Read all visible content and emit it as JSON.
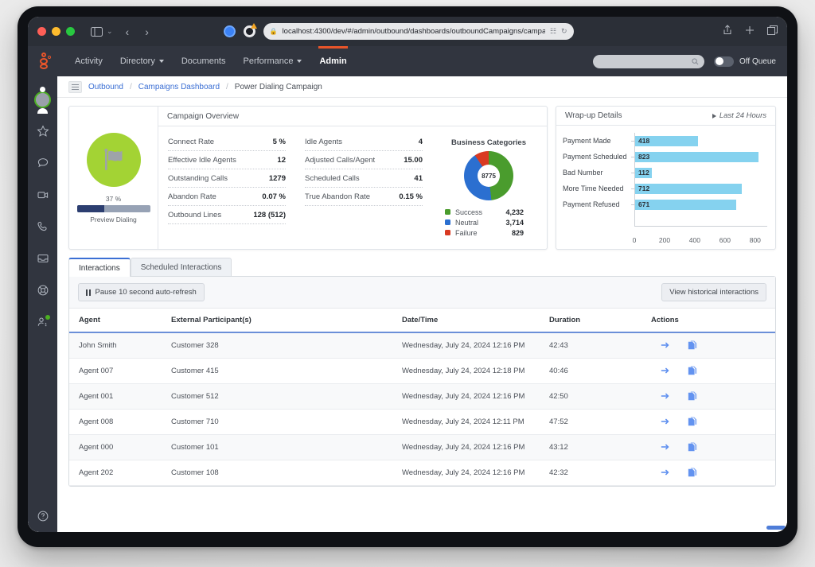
{
  "browser": {
    "url_visible": "localhost:4300/dev/#/admin/outbound/dashboards/outboundCampaigns/campaignDe",
    "url_truncated_tail": "campaignDe",
    "lock_icon": "lock-icon",
    "back_label": "‹",
    "forward_label": "›",
    "chevron": "⌄"
  },
  "topnav": {
    "items": [
      {
        "label": "Activity",
        "has_caret": false,
        "active": false
      },
      {
        "label": "Directory",
        "has_caret": true,
        "active": false
      },
      {
        "label": "Documents",
        "has_caret": false,
        "active": false
      },
      {
        "label": "Performance",
        "has_caret": true,
        "active": false
      },
      {
        "label": "Admin",
        "has_caret": false,
        "active": true
      }
    ],
    "search_placeholder": "",
    "queue_toggle_label": "Off Queue",
    "queue_toggle_state": "off"
  },
  "rail": {
    "items": [
      "avatar",
      "star-icon",
      "chat-icon",
      "video-icon",
      "phone-icon",
      "inbox-icon",
      "lifebuoy-icon",
      "people-icon"
    ],
    "help_label": "?"
  },
  "breadcrumb": {
    "items": [
      {
        "label": "Outbound",
        "current": false
      },
      {
        "label": "Campaigns Dashboard",
        "current": false
      },
      {
        "label": "Power Dialing Campaign",
        "current": true
      }
    ],
    "separator": "/"
  },
  "gauge": {
    "percent_label": "37 %",
    "percent_value": 37,
    "caption": "Preview Dialing",
    "circle_color": "#a3d334",
    "bar_fill_color": "#2c3e70",
    "bar_track_color": "#97a2b5",
    "icon": "flag-icon"
  },
  "overview": {
    "title": "Campaign Overview",
    "column_left": [
      {
        "label": "Connect Rate",
        "value": "5 %"
      },
      {
        "label": "Effective Idle Agents",
        "value": "12"
      },
      {
        "label": "Outstanding Calls",
        "value": "1279"
      },
      {
        "label": "Abandon Rate",
        "value": "0.07 %"
      },
      {
        "label": "Outbound Lines",
        "value": "128 (512)"
      }
    ],
    "column_right": [
      {
        "label": "Idle Agents",
        "value": "4"
      },
      {
        "label": "Adjusted Calls/Agent",
        "value": "15.00"
      },
      {
        "label": "Scheduled Calls",
        "value": "41"
      },
      {
        "label": "True Abandon Rate",
        "value": "0.15 %"
      }
    ]
  },
  "chart_data": [
    {
      "type": "pie",
      "title": "Business Categories",
      "center_label": "8775",
      "total": 8775,
      "categories": [
        "Success",
        "Neutral",
        "Failure"
      ],
      "values": [
        4232,
        3714,
        829
      ],
      "value_labels": [
        "4,232",
        "3,714",
        "829"
      ],
      "colors": [
        "#4a9c2d",
        "#2b6fd0",
        "#d93a22"
      ],
      "legend": "bottom"
    },
    {
      "type": "bar",
      "orientation": "horizontal",
      "title": "Wrap-up Details",
      "subtitle": "Last 24 Hours",
      "categories": [
        "Payment Made",
        "Payment Scheduled",
        "Bad Number",
        "More Time Needed",
        "Payment Refused"
      ],
      "values": [
        418,
        823,
        112,
        712,
        671
      ],
      "value_labels": [
        "418",
        "823",
        "112",
        "712",
        "671"
      ],
      "xlabel": "",
      "ylabel": "",
      "xlim": [
        0,
        880
      ],
      "xticks": [
        0,
        200,
        400,
        600,
        800
      ],
      "xtick_labels": [
        "0",
        "200",
        "400",
        "600",
        "800"
      ],
      "bar_color": "#85d2ef",
      "grid": false
    }
  ],
  "wrapup": {
    "title": "Wrap-up Details",
    "range_label": "Last 24 Hours"
  },
  "tabs": [
    {
      "label": "Interactions",
      "active": true
    },
    {
      "label": "Scheduled Interactions",
      "active": false
    }
  ],
  "toolbar": {
    "pause_label": "Pause 10 second auto-refresh",
    "historical_label": "View historical interactions"
  },
  "table": {
    "headers": [
      "Agent",
      "External Participant(s)",
      "Date/Time",
      "Duration",
      "Actions"
    ],
    "rows": [
      {
        "agent": "John Smith",
        "participant": "Customer 328",
        "datetime": "Wednesday, July 24, 2024 12:16 PM",
        "duration": "42:43"
      },
      {
        "agent": "Agent 007",
        "participant": "Customer 415",
        "datetime": "Wednesday, July 24, 2024 12:18 PM",
        "duration": "40:46"
      },
      {
        "agent": "Agent 001",
        "participant": "Customer 512",
        "datetime": "Wednesday, July 24, 2024 12:16 PM",
        "duration": "42:50"
      },
      {
        "agent": "Agent 008",
        "participant": "Customer 710",
        "datetime": "Wednesday, July 24, 2024 12:11 PM",
        "duration": "47:52"
      },
      {
        "agent": "Agent 000",
        "participant": "Customer 101",
        "datetime": "Wednesday, July 24, 2024 12:16 PM",
        "duration": "43:12"
      },
      {
        "agent": "Agent 202",
        "participant": "Customer 108",
        "datetime": "Wednesday, July 24, 2024 12:16 PM",
        "duration": "42:32"
      }
    ],
    "row_actions": [
      "arrow-right-icon",
      "copy-icon"
    ]
  }
}
